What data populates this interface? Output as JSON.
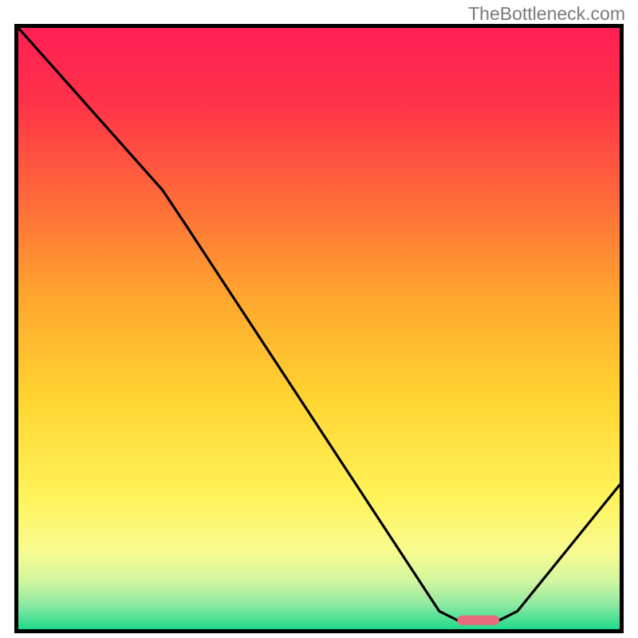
{
  "watermark": "TheBottleneck.com",
  "chart_data": {
    "type": "line",
    "title": "",
    "xlabel": "",
    "ylabel": "",
    "xlim": [
      0,
      100
    ],
    "ylim": [
      0,
      100
    ],
    "grid": false,
    "legend": false,
    "background_gradient": {
      "stops": [
        {
          "offset": 0.0,
          "color": "#ff1f55"
        },
        {
          "offset": 0.12,
          "color": "#ff3149"
        },
        {
          "offset": 0.28,
          "color": "#ff683a"
        },
        {
          "offset": 0.45,
          "color": "#ffa72e"
        },
        {
          "offset": 0.62,
          "color": "#ffd531"
        },
        {
          "offset": 0.78,
          "color": "#fff35a"
        },
        {
          "offset": 0.87,
          "color": "#f8fb8f"
        },
        {
          "offset": 0.92,
          "color": "#d2f6a0"
        },
        {
          "offset": 0.96,
          "color": "#8be9a2"
        },
        {
          "offset": 1.0,
          "color": "#1fd98b"
        }
      ]
    },
    "series": [
      {
        "name": "bottleneck-curve",
        "stroke": "#000000",
        "points": [
          {
            "x": 0,
            "y": 100
          },
          {
            "x": 24,
            "y": 73
          },
          {
            "x": 28,
            "y": 67
          },
          {
            "x": 70,
            "y": 3
          },
          {
            "x": 73,
            "y": 1.5
          },
          {
            "x": 80,
            "y": 1.5
          },
          {
            "x": 83,
            "y": 3
          },
          {
            "x": 100,
            "y": 24
          }
        ]
      }
    ],
    "marker": {
      "name": "optimal-region",
      "x_start": 73,
      "x_end": 80,
      "y": 1.5,
      "color": "#e96a7a"
    }
  }
}
